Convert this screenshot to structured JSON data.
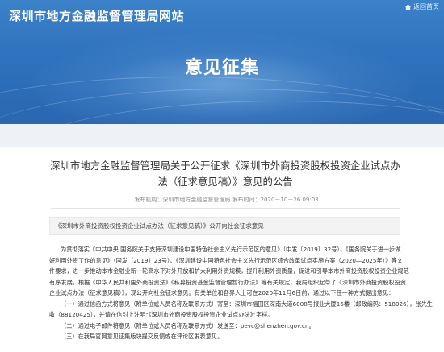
{
  "header": {
    "site_title": "深圳市地方金融监督管理局网站",
    "back_link": "返回首页",
    "hero_title": "意见征集"
  },
  "article": {
    "headline": "深圳市地方金融监督管理局关于公开征求《深圳市外商投资股权投资企业试点办法（征求意见稿）》意见的公告",
    "meta": "发布机构：深圳市地方金融监督管理局    发布时间：2020－10－26 09:03",
    "summary": "《深圳市外商投资股权投资企业试点办法（征求意见稿）》公开向社会征求意见",
    "body_lines": [
      "为贯彻落实《中共中央 国务院关于支持深圳建设中国特色社会主义先行示范区的意见》（中发〔2019〕32号）、《国务院关于进一步做",
      "好利用外资工作的意见》（国发〔2019〕23号）、《深圳建设中国特色社会主义先行示范区综合改革试点实施方案（2020—2025年）》等文",
      "件要求，进一步推动本市金融业新一轮高水平对外开放和扩大利用外资规模，提升利用外资质量，促进和引导本市外商投资股权投资企业规范",
      "有序发展，根据《中华人民共和国外商投资法》《私募投资基金监督管理暂行办法》等有关规定，我局组织起草了《深圳市外商投资股权投资",
      "企业试点办法（征求意见稿）》，现公开向社会征求意见。有关单位和各界人士可在2020年11月6日前，通过以下任一种方式提出意见：",
      "（一）通过信函方式将意见（附单位或人员名称及联系方式）寄至：深圳市福田区深南大道6008号报业大厦16楼（邮政编码：518026），张先生",
      "收（88120425），并请在信封上注明“《深圳市外商投资股权投资企业试点办法》”字样。",
      "（二）通过电子邮件将意见（附单位或人员名称及联系方式）发送至：pevc@shenzhen.gov.cn。",
      "（三）在我局官网意见征集版块提交反馈或在评论区发表意见。"
    ]
  },
  "colors": {
    "header_blue": "#2f72bd",
    "band_bg": "#eef2f6",
    "text": "#333333"
  },
  "icons": {
    "back_link_icon": "home-icon"
  }
}
